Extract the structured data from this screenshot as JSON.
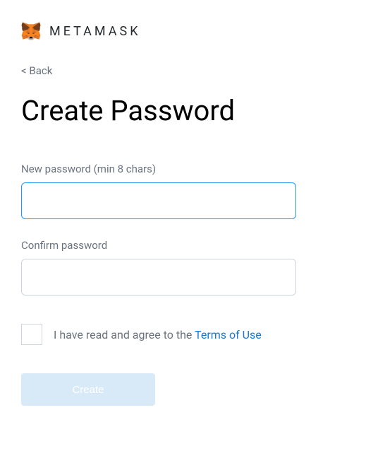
{
  "header": {
    "brand": "METAMASK"
  },
  "back": {
    "label": "< Back"
  },
  "title": "Create Password",
  "fields": {
    "new_password": {
      "label": "New password (min 8 chars)",
      "value": ""
    },
    "confirm_password": {
      "label": "Confirm password",
      "value": ""
    }
  },
  "terms": {
    "prefix": "I have read and agree to the ",
    "link": "Terms of Use"
  },
  "button": {
    "create": "Create"
  }
}
